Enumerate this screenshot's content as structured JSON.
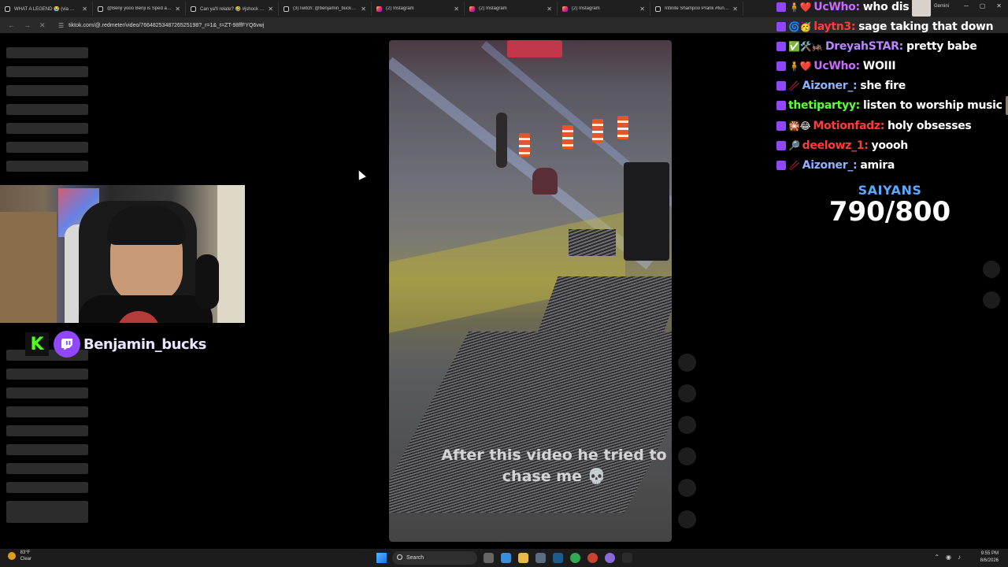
{
  "browser": {
    "tabs": [
      {
        "label": "WHAT A LEGEND 😭 (via @Ati…",
        "icon": "tiktok-icon"
      },
      {
        "label": "@Benji yooo Benji is Sped at li…",
        "icon": "tiktok-icon"
      },
      {
        "label": "Can ya'll relate? 🤣 #jshock #…",
        "icon": "tiktok-icon"
      },
      {
        "label": "(3)Twitch: @benjamin_bucks | …",
        "icon": "tiktok-icon"
      },
      {
        "label": "(2) Instagram",
        "icon": "instagram-icon"
      },
      {
        "label": "(2) Instagram",
        "icon": "instagram-icon"
      },
      {
        "label": "(2) Instagram",
        "icon": "instagram-icon"
      },
      {
        "label": "Infinite Shampoo Prank #funny…",
        "icon": "tiktok-icon"
      }
    ],
    "gemini_label": "Gemini",
    "url": "tiktok.com/@.redmeter/video/7664825348726525198?_r=1&_t=ZT-98ffFYQ6vwj"
  },
  "streamer": {
    "username": "Benjamin_bucks"
  },
  "video": {
    "caption_line1": "After this video he tried to",
    "caption_line2": "chase me 💀"
  },
  "chat": [
    {
      "user": "UcWho:",
      "text": "who dis",
      "color": "#c86bff",
      "emotes": "🧍❤️",
      "avatar": true
    },
    {
      "user": "laytn3:",
      "text": "sage taking that down",
      "color": "#ff3b3b",
      "emotes": "🌀🥳"
    },
    {
      "user": "DreyahSTAR:",
      "text": "pretty babe",
      "color": "#b987ff",
      "emotes": "✅🛠️🦗"
    },
    {
      "user": "UcWho:",
      "text": "WOIII",
      "color": "#c86bff",
      "emotes": "🧍❤️"
    },
    {
      "user": "Aizoner_:",
      "text": "she fire",
      "color": "#8fb3ff",
      "emotes": "🥢"
    },
    {
      "user": "thetipartyy:",
      "text": "listen to worship music",
      "color": "#5dff3a",
      "emotes": "",
      "avatar": true
    },
    {
      "user": "Motionfadz:",
      "text": "holy obsesses",
      "color": "#ff3b3b",
      "emotes": "🎇😂"
    },
    {
      "user": "deelowz_1:",
      "text": "yoooh",
      "color": "#ff3b3b",
      "emotes": "🔎"
    },
    {
      "user": "Aizoner_:",
      "text": "amira",
      "color": "#8fb3ff",
      "emotes": "🥢"
    }
  ],
  "counter": {
    "label": "SAIYANS",
    "value": "790/800"
  },
  "taskbar": {
    "weather_temp": "83°F",
    "weather_cond": "Clear",
    "search_label": "Search",
    "time": "9:55 PM",
    "date": "8/6/2026"
  }
}
